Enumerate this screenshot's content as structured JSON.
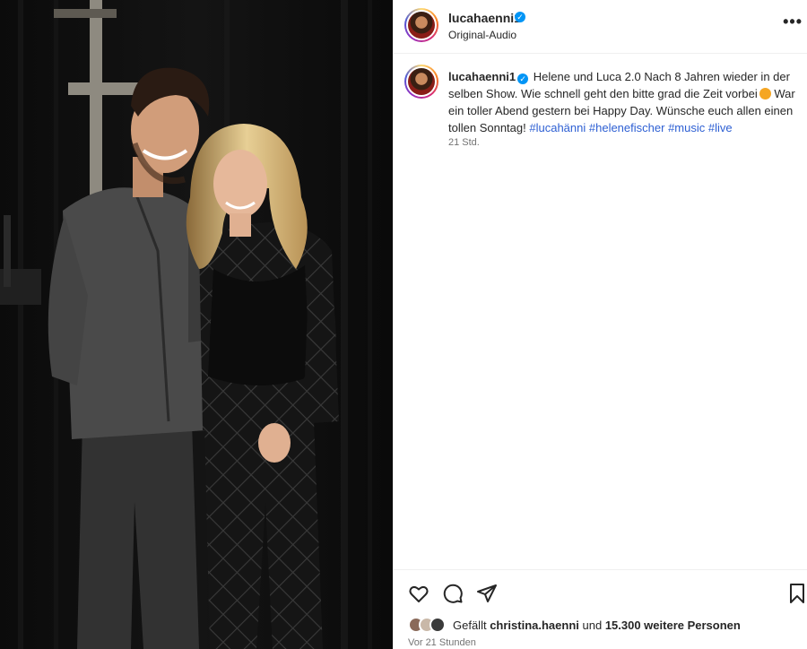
{
  "header": {
    "username": "lucahaenni1",
    "audio": "Original-Audio",
    "more_label": "•••"
  },
  "caption": {
    "username": "lucahaenni1",
    "text_part1": "Helene und Luca 2.0 Nach 8 Jahren wieder in der selben Show. Wie schnell geht den bitte grad die Zeit vorbei",
    "text_part2": " War ein toller Abend gestern bei Happy Day. Wünsche euch allen einen tollen Sonntag! ",
    "hashtags": [
      "#lucahänni",
      "#helenefischer",
      "#music",
      "#live"
    ],
    "time": "21 Std."
  },
  "likes": {
    "prefix": "Gefällt ",
    "user": "christina.haenni",
    "middle": " und ",
    "count": "15.300 weitere Personen"
  },
  "posted": "Vor 21 Stunden",
  "icons": {
    "like": "heart-icon",
    "comment": "comment-icon",
    "share": "share-icon",
    "save": "bookmark-icon",
    "verified": "verified-badge-icon"
  },
  "colors": {
    "verified": "#0095f6",
    "hashtag": "#2d5fd3",
    "muted": "#737373"
  }
}
